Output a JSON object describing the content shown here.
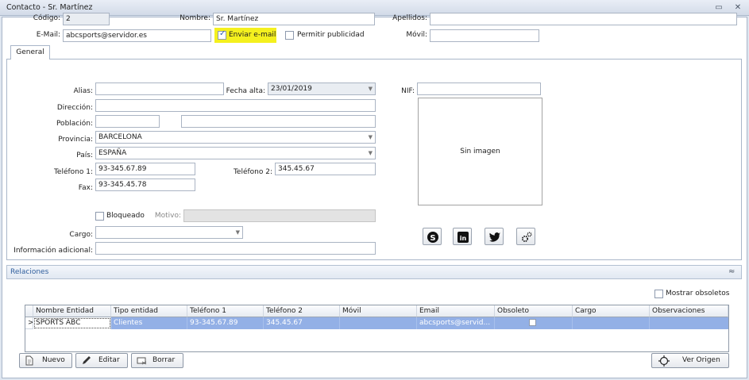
{
  "window": {
    "title": "Contacto - Sr. Martínez",
    "min_glyph": "▭",
    "close_glyph": "✕"
  },
  "header": {
    "codigo_label": "Código:",
    "codigo_value": "2",
    "nombre_label": "Nombre:",
    "nombre_value": "Sr. Martínez",
    "apellidos_label": "Apellidos:",
    "apellidos_value": "",
    "email_label": "E-Mail:",
    "email_value": "abcsports@servidor.es",
    "enviar_email_label": "Enviar e-mail",
    "enviar_email_checked": true,
    "permitir_publicidad_label": "Permitir publicidad",
    "permitir_publicidad_checked": false,
    "movil_label": "Móvil:",
    "movil_value": ""
  },
  "tabs": [
    {
      "label": "General",
      "active": true
    }
  ],
  "general": {
    "alias_label": "Alias:",
    "alias_value": "",
    "fecha_alta_label": "Fecha alta:",
    "fecha_alta_value": "23/01/2019",
    "nif_label": "NIF:",
    "nif_value": "",
    "direccion_label": "Dirección:",
    "direccion_value": "",
    "poblacion_label": "Población:",
    "poblacion_cp_value": "",
    "poblacion_value": "",
    "provincia_label": "Provincia:",
    "provincia_value": "BARCELONA",
    "pais_label": "País:",
    "pais_value": "ESPAÑA",
    "telefono1_label": "Teléfono 1:",
    "telefono1_value": "93-345.67.89",
    "telefono2_label": "Teléfono 2:",
    "telefono2_value": "345.45.67",
    "fax_label": "Fax:",
    "fax_value": "93-345.45.78",
    "bloqueado_label": "Bloqueado",
    "bloqueado_checked": false,
    "motivo_label": "Motivo:",
    "motivo_value": "",
    "cargo_label": "Cargo:",
    "cargo_value": "",
    "info_adicional_label": "Información adicional:",
    "info_adicional_value": "",
    "imagen_placeholder": "Sin imagen",
    "social_icons": [
      "skype-icon",
      "linkedin-icon",
      "twitter-icon",
      "settings-gears-icon"
    ]
  },
  "relaciones": {
    "title": "Relaciones",
    "collapse_glyph": "≈",
    "mostrar_obsoletos_label": "Mostrar obsoletos",
    "mostrar_obsoletos_checked": false,
    "columns": [
      "Nombre Entidad",
      "Tipo entidad",
      "Teléfono 1",
      "Teléfono 2",
      "Móvil",
      "Email",
      "Obsoleto",
      "Cargo",
      "Observaciones"
    ],
    "rows": [
      [
        "SPORTS ABC",
        "Clientes",
        "93-345.67.89",
        "345.45.67",
        "",
        "abcsports@servid...",
        "",
        "",
        ""
      ]
    ],
    "row_indicator": ">",
    "buttons": {
      "nuevo": "Nuevo",
      "editar": "Editar",
      "borrar": "Borrar",
      "ver_origen": "Ver Origen"
    }
  },
  "colors": {
    "selection": "#93b0e6",
    "highlight": "#f4f01e",
    "section_title": "#2e5d9c"
  }
}
